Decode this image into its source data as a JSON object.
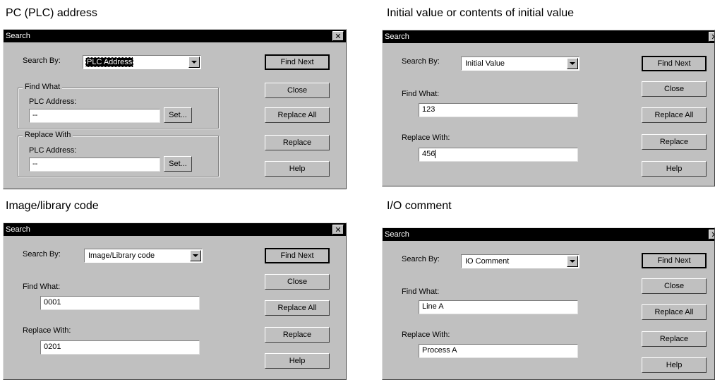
{
  "captions": {
    "plc": "PC (PLC) address",
    "initial": "Initial value or contents of initial value",
    "image": "Image/library code",
    "io": "I/O comment"
  },
  "dialog_title": "Search",
  "close_glyph": "✕",
  "labels": {
    "search_by": "Search By:",
    "find_what": "Find What:",
    "replace_with": "Replace With:",
    "find_what_group": "Find What",
    "replace_with_group": "Replace With",
    "plc_address": "PLC Address:",
    "set": "Set..."
  },
  "buttons": {
    "find_next": "Find Next",
    "close": "Close",
    "replace_all": "Replace All",
    "replace": "Replace",
    "help": "Help"
  },
  "dialogs": {
    "plc": {
      "search_by_value": "PLC Address",
      "find_value": "--",
      "replace_value": "--"
    },
    "initial": {
      "search_by_value": "Initial Value",
      "find_value": "123",
      "replace_value": "456"
    },
    "image": {
      "search_by_value": "Image/Library code",
      "find_value": "0001",
      "replace_value": "0201"
    },
    "io": {
      "search_by_value": "IO Comment",
      "find_value": "Line A",
      "replace_value": "Process A"
    }
  },
  "icons": {
    "close": "close-icon",
    "dropdown": "chevron-down-icon"
  }
}
